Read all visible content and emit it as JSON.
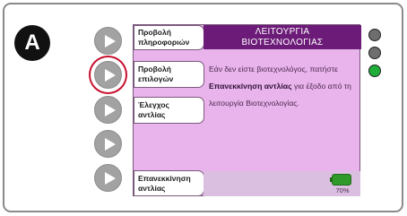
{
  "step_label": "A",
  "header": {
    "line1": "ΛΕΙΤΟΥΡΓΙΑ",
    "line2": "ΒΙΟΤΕΧΝΟΛΟΓΙΑΣ"
  },
  "softkeys": [
    {
      "line1": "Προβολή",
      "line2": "πληροφοριών"
    },
    {
      "line1": "Προβολή",
      "line2": "επιλογών"
    },
    {
      "line1": "Έλεγχος",
      "line2": "αντλίας"
    },
    {
      "line1": "Επανεκκίνηση",
      "line2": "αντλίας"
    }
  ],
  "message": {
    "part1": "Εάν δεν είστε βιοτεχνολόγος, πατήστε",
    "bold": "Επανεκκίνηση αντλίας",
    "part2": "για έξοδο από τη λειτουργία Βιοτεχνολογίας."
  },
  "battery": {
    "level_text": "70%",
    "fraction": 0.7
  },
  "indicator_lights": [
    {
      "name": "grey",
      "color": "#6e6e6e"
    },
    {
      "name": "grey",
      "color": "#6e6e6e"
    },
    {
      "name": "green",
      "color": "#1fae3a"
    }
  ],
  "colors": {
    "screen_bg": "#e9b3ec",
    "header_bg": "#6c1c78",
    "highlight_ring": "#c8102e"
  }
}
